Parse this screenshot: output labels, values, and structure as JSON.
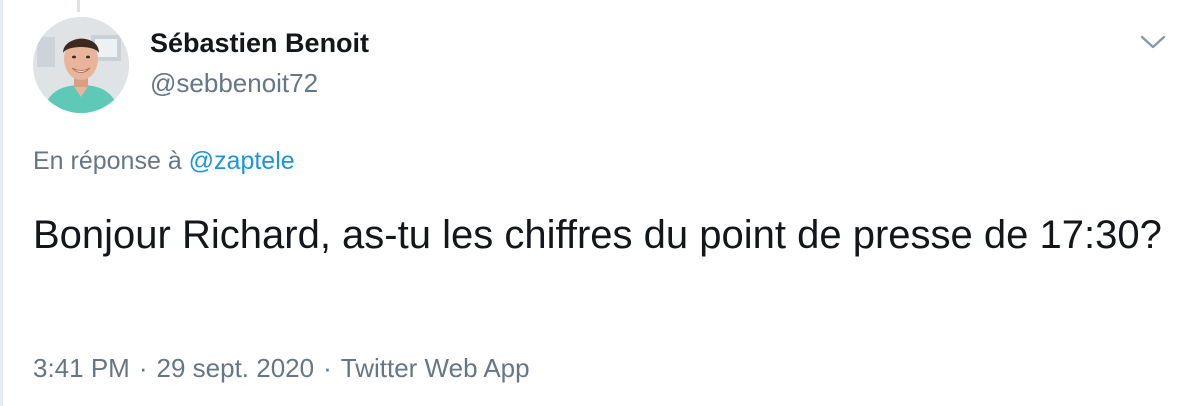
{
  "author": {
    "display_name": "Sébastien Benoit",
    "handle": "@sebbenoit72"
  },
  "reply": {
    "prefix": "En réponse à ",
    "mention": "@zaptele"
  },
  "tweet": {
    "text": "Bonjour Richard, as-tu les chiffres du point de presse de 17:30?"
  },
  "meta": {
    "time": "3:41 PM",
    "separator": "·",
    "date": "29 sept. 2020",
    "source": "Twitter Web App"
  },
  "icons": {
    "menu": "chevron-down-icon"
  },
  "colors": {
    "text": "#14171a",
    "secondary": "#657786",
    "link": "#1b95e0",
    "border": "#e6ecf0"
  }
}
